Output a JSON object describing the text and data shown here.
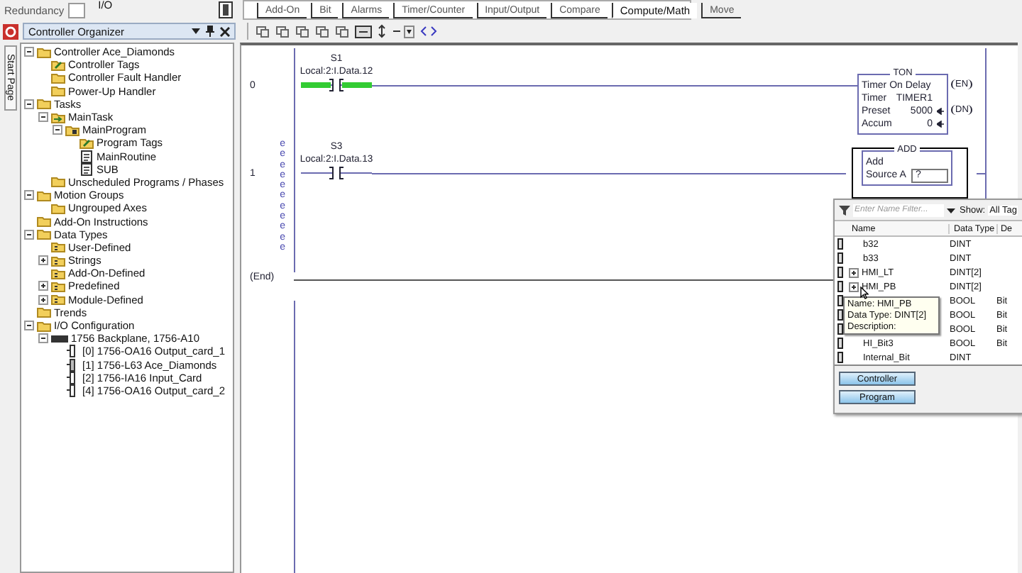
{
  "top_bar": {
    "redundancy_label": "Redundancy",
    "io_label": "I/O"
  },
  "palette": {
    "tabs": [
      {
        "label": "Add-On",
        "selected": false
      },
      {
        "label": "Bit",
        "selected": false
      },
      {
        "label": "Alarms",
        "selected": false
      },
      {
        "label": "Timer/Counter",
        "selected": false
      },
      {
        "label": "Input/Output",
        "selected": false
      },
      {
        "label": "Compare",
        "selected": false
      },
      {
        "label": "Compute/Math",
        "selected": true
      },
      {
        "label": "Move",
        "selected": false
      }
    ]
  },
  "organizer": {
    "title": "Controller Organizer",
    "tree": [
      {
        "label": "Controller Ace_Diamonds",
        "kind": "folder",
        "expanded": true,
        "children": [
          {
            "label": "Controller Tags",
            "kind": "tags"
          },
          {
            "label": "Controller Fault Handler",
            "kind": "folder"
          },
          {
            "label": "Power-Up Handler",
            "kind": "folder"
          }
        ]
      },
      {
        "label": "Tasks",
        "kind": "folder",
        "expanded": true,
        "children": [
          {
            "label": "MainTask",
            "kind": "task",
            "expanded": true,
            "children": [
              {
                "label": "MainProgram",
                "kind": "program",
                "expanded": true,
                "children": [
                  {
                    "label": "Program Tags",
                    "kind": "tags"
                  },
                  {
                    "label": "MainRoutine",
                    "kind": "routine"
                  },
                  {
                    "label": "SUB",
                    "kind": "routine"
                  }
                ]
              }
            ]
          },
          {
            "label": "Unscheduled Programs / Phases",
            "kind": "folder"
          }
        ]
      },
      {
        "label": "Motion Groups",
        "kind": "folder",
        "expanded": true,
        "children": [
          {
            "label": "Ungrouped Axes",
            "kind": "folder"
          }
        ]
      },
      {
        "label": "Add-On Instructions",
        "kind": "folder"
      },
      {
        "label": "Data Types",
        "kind": "folder",
        "expanded": true,
        "children": [
          {
            "label": "User-Defined",
            "kind": "types"
          },
          {
            "label": "Strings",
            "kind": "types",
            "expanded": false
          },
          {
            "label": "Add-On-Defined",
            "kind": "types"
          },
          {
            "label": "Predefined",
            "kind": "types",
            "expanded": false
          },
          {
            "label": "Module-Defined",
            "kind": "types",
            "expanded": false
          }
        ]
      },
      {
        "label": "Trends",
        "kind": "folder"
      },
      {
        "label": "I/O Configuration",
        "kind": "folder",
        "expanded": true,
        "children": [
          {
            "label": "1756 Backplane, 1756-A10",
            "kind": "chassis",
            "expanded": true,
            "children": [
              {
                "label": "[0] 1756-OA16 Output_card_1",
                "kind": "module"
              },
              {
                "label": "[1] 1756-L63 Ace_Diamonds",
                "kind": "processor"
              },
              {
                "label": "[2] 1756-IA16 Input_Card",
                "kind": "module"
              },
              {
                "label": "[4] 1756-OA16 Output_card_2",
                "kind": "module"
              }
            ]
          }
        ]
      }
    ]
  },
  "side_tab": {
    "label": "Start Page"
  },
  "ladder": {
    "rungs": [
      {
        "number": "0",
        "contact": {
          "tag": "S1",
          "address": "Local:2:I.Data.12",
          "energized": true
        },
        "instruction": {
          "kind": "timer",
          "selected": false,
          "mnemonic": "TON",
          "title": "Timer On Delay",
          "params": [
            {
              "name": "Timer",
              "value": "TIMER1",
              "value_arrow": false
            },
            {
              "name": "Preset",
              "value": "5000",
              "value_arrow": true
            },
            {
              "name": "Accum",
              "value": "0",
              "value_arrow": true
            }
          ],
          "outputs": [
            "EN",
            "DN"
          ]
        }
      },
      {
        "number": "1",
        "error_marks": [
          "e",
          "e",
          "e",
          "e",
          "e",
          "e",
          "e",
          "e",
          "e",
          "e",
          "e"
        ],
        "contact": {
          "tag": "S3",
          "address": "Local:2:I.Data.13",
          "energized": false
        },
        "instruction": {
          "kind": "math",
          "selected": true,
          "mnemonic": "ADD",
          "title": "Add",
          "params": [
            {
              "name": "Source A",
              "value": "?"
            }
          ]
        }
      }
    ],
    "end_label": "(End)"
  },
  "tag_browser": {
    "filter_placeholder": "Enter Name Filter...",
    "show_label": "Show:",
    "show_value": "All Tag",
    "columns": [
      "Name",
      "Data Type",
      "De"
    ],
    "rows": [
      {
        "name": "b32",
        "type": "DINT"
      },
      {
        "name": "b33",
        "type": "DINT"
      },
      {
        "name": "HMI_LT",
        "type": "DINT[2]",
        "expanded": false
      },
      {
        "name": "HMI_PB",
        "type": "DINT[2]",
        "expanded": false
      },
      {
        "type": "BOOL",
        "description": "Bit"
      },
      {
        "type": "BOOL",
        "description": "Bit"
      },
      {
        "type": "BOOL",
        "description": "Bit"
      },
      {
        "name": "HI_Bit3",
        "type": "BOOL",
        "description": "Bit"
      },
      {
        "name": "Internal_Bit",
        "type": "DINT"
      }
    ],
    "tooltip": [
      "Name: HMI_PB",
      "Data Type: DINT[2]",
      "Description:"
    ],
    "buttons": [
      "Controller",
      "Program"
    ]
  }
}
